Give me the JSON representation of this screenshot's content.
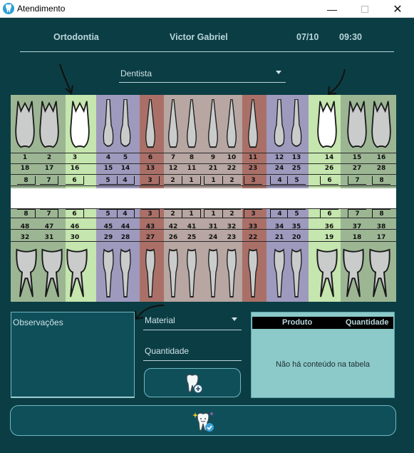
{
  "window": {
    "title": "Atendimento",
    "controls": {
      "minimize": "—",
      "maximize": "",
      "close": "✕"
    }
  },
  "header": {
    "specialty": "Ortodontia",
    "patient": "Victor Gabriel",
    "date": "07/10",
    "time": "09:30"
  },
  "dentist_select": {
    "selected": "Dentista"
  },
  "odontogram": {
    "upper": {
      "row1": [
        "1",
        "2",
        "3",
        "4",
        "5",
        "6",
        "7",
        "8",
        "9",
        "10",
        "11",
        "12",
        "13",
        "14",
        "15",
        "16"
      ],
      "row2": [
        "18",
        "17",
        "16",
        "15",
        "14",
        "13",
        "12",
        "11",
        "21",
        "22",
        "23",
        "24",
        "25",
        "26",
        "27",
        "28"
      ],
      "row3": [
        "8",
        "7",
        "6",
        "5",
        "4",
        "3",
        "2",
        "1",
        "1",
        "2",
        "3",
        "4",
        "5",
        "6",
        "7",
        "8"
      ]
    },
    "lower": {
      "row1": [
        "8",
        "7",
        "6",
        "5",
        "4",
        "3",
        "2",
        "1",
        "1",
        "2",
        "3",
        "4",
        "5",
        "6",
        "7",
        "8"
      ],
      "row2": [
        "48",
        "47",
        "46",
        "45",
        "44",
        "43",
        "42",
        "41",
        "31",
        "32",
        "33",
        "34",
        "35",
        "36",
        "37",
        "38"
      ],
      "row3": [
        "32",
        "31",
        "30",
        "29",
        "28",
        "27",
        "26",
        "25",
        "24",
        "23",
        "22",
        "21",
        "20",
        "19",
        "18",
        "17"
      ]
    },
    "colors": {
      "molar": "#9cb694",
      "premolar": "#9e9abe",
      "canine": "#aa7068",
      "incisor": "#b7a6a1",
      "selected": "#c5e6ae"
    }
  },
  "observations": {
    "placeholder": "Observações"
  },
  "material_select": {
    "selected": "Material"
  },
  "quantity": {
    "placeholder": "Quantidade"
  },
  "add_button": {
    "icon": "tooth-plus-icon"
  },
  "products_table": {
    "columns": [
      "Produto",
      "Quantidade"
    ],
    "empty_message": "Não há conteúdo na tabela"
  },
  "finish_button": {
    "icon": "tooth-check-icon"
  }
}
